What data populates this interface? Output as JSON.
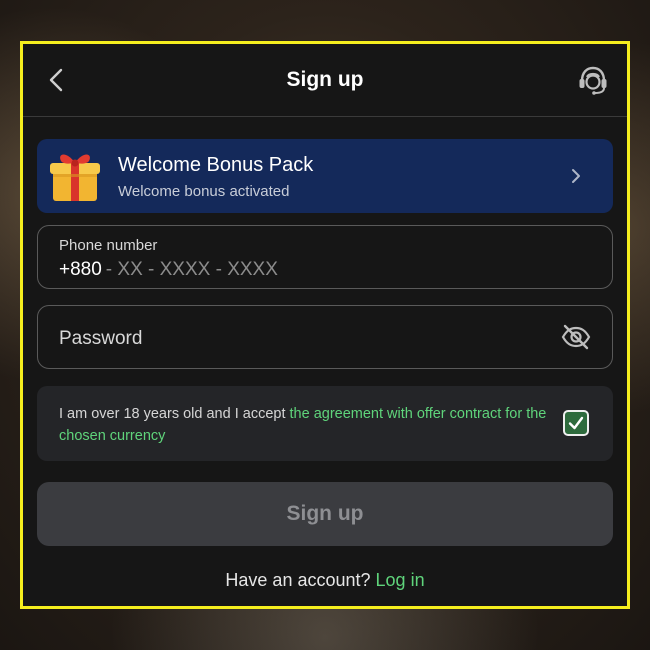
{
  "header": {
    "title": "Sign up",
    "back_icon": "chevron-left-icon",
    "support_icon": "headset-support-icon"
  },
  "bonus": {
    "title": "Welcome Bonus Pack",
    "subtitle": "Welcome bonus activated",
    "icon": "gift-icon"
  },
  "phone": {
    "label": "Phone number",
    "prefix": "+880",
    "placeholder": "- XX - XXXX - XXXX"
  },
  "password": {
    "placeholder": "Password",
    "toggle_icon": "eye-slash-icon"
  },
  "agreement": {
    "text": "I am over 18 years old and I accept ",
    "link": "the agreement with offer contract for the chosen currency",
    "checked": true
  },
  "submit": {
    "label": "Sign up"
  },
  "login": {
    "prompt": "Have an account?",
    "link": "Log in"
  },
  "colors": {
    "accent_green": "#5fd47b",
    "bonus_bg": "#14295a",
    "panel_border": "#f5ee1e",
    "panel_bg": "#161616"
  }
}
